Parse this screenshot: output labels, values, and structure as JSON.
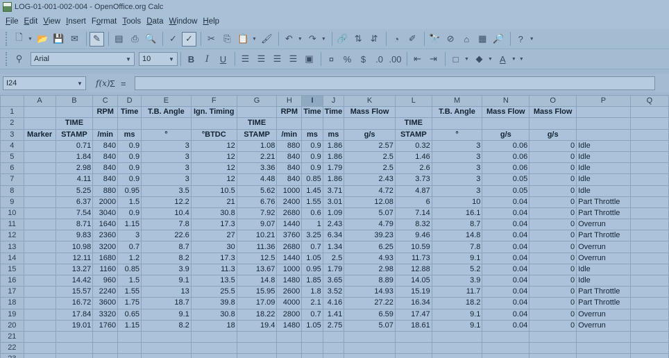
{
  "window": {
    "title": "LOG-01-001-002-004 - OpenOffice.org Calc"
  },
  "menu": [
    {
      "pre": "",
      "u": "F",
      "post": "ile"
    },
    {
      "pre": "",
      "u": "E",
      "post": "dit"
    },
    {
      "pre": "",
      "u": "V",
      "post": "iew"
    },
    {
      "pre": "",
      "u": "I",
      "post": "nsert"
    },
    {
      "pre": "F",
      "u": "o",
      "post": "rmat"
    },
    {
      "pre": "",
      "u": "T",
      "post": "ools"
    },
    {
      "pre": "",
      "u": "D",
      "post": "ata"
    },
    {
      "pre": "",
      "u": "W",
      "post": "indow"
    },
    {
      "pre": "",
      "u": "H",
      "post": "elp"
    }
  ],
  "format": {
    "font_name": "Arial",
    "font_size": "10",
    "bold": "B",
    "italic": "I",
    "underline": "U"
  },
  "formula_bar": {
    "cell_ref": "I24",
    "fx": "f(x)",
    "sigma": "Σ",
    "equals": "=",
    "content": ""
  },
  "colors": {
    "accent": "#5b7a96",
    "sheet_bg": "#aac3da",
    "header_bg": "#a7bed3"
  },
  "columns": [
    "A",
    "B",
    "C",
    "D",
    "E",
    "F",
    "G",
    "H",
    "I",
    "J",
    "K",
    "L",
    "M",
    "N",
    "O",
    "P",
    "Q"
  ],
  "selected_column": "I",
  "rows": [
    {
      "n": "1",
      "c": [
        "",
        "",
        "RPM",
        "Time",
        "T.B. Angle",
        "Ign. Timing",
        "",
        "RPM",
        "Time",
        "Time",
        "Mass Flow",
        "",
        "T.B. Angle",
        "Mass Flow",
        "Mass Flow",
        "",
        ""
      ]
    },
    {
      "n": "2",
      "c": [
        "",
        "TIME",
        "",
        "",
        "",
        "",
        "TIME",
        "",
        "",
        "",
        "",
        "TIME",
        "",
        "",
        "",
        "",
        ""
      ]
    },
    {
      "n": "3",
      "c": [
        "Marker",
        "STAMP",
        "/min",
        "ms",
        "°",
        "°BTDC",
        "STAMP",
        "/min",
        "ms",
        "ms",
        "g/s",
        "STAMP",
        "°",
        "g/s",
        "g/s",
        "",
        ""
      ]
    },
    {
      "n": "4",
      "c": [
        "",
        "0.71",
        "840",
        "0.9",
        "3",
        "12",
        "1.08",
        "880",
        "0.9",
        "1.86",
        "2.57",
        "0.32",
        "3",
        "0.06",
        "0",
        "Idle",
        ""
      ]
    },
    {
      "n": "5",
      "c": [
        "",
        "1.84",
        "840",
        "0.9",
        "3",
        "12",
        "2.21",
        "840",
        "0.9",
        "1.86",
        "2.5",
        "1.46",
        "3",
        "0.06",
        "0",
        "Idle",
        ""
      ]
    },
    {
      "n": "6",
      "c": [
        "",
        "2.98",
        "840",
        "0.9",
        "3",
        "12",
        "3.36",
        "840",
        "0.9",
        "1.79",
        "2.5",
        "2.6",
        "3",
        "0.06",
        "0",
        "Idle",
        ""
      ]
    },
    {
      "n": "7",
      "c": [
        "",
        "4.11",
        "840",
        "0.9",
        "3",
        "12",
        "4.48",
        "840",
        "0.85",
        "1.86",
        "2.43",
        "3.73",
        "3",
        "0.05",
        "0",
        "Idle",
        ""
      ]
    },
    {
      "n": "8",
      "c": [
        "",
        "5.25",
        "880",
        "0.95",
        "3.5",
        "10.5",
        "5.62",
        "1000",
        "1.45",
        "3.71",
        "4.72",
        "4.87",
        "3",
        "0.05",
        "0",
        "Idle",
        ""
      ]
    },
    {
      "n": "9",
      "c": [
        "",
        "6.37",
        "2000",
        "1.5",
        "12.2",
        "21",
        "6.76",
        "2400",
        "1.55",
        "3.01",
        "12.08",
        "6",
        "10",
        "0.04",
        "0",
        "Part Throttle",
        ""
      ]
    },
    {
      "n": "10",
      "c": [
        "",
        "7.54",
        "3040",
        "0.9",
        "10.4",
        "30.8",
        "7.92",
        "2680",
        "0.6",
        "1.09",
        "5.07",
        "7.14",
        "16.1",
        "0.04",
        "0",
        "Part Throttle",
        ""
      ]
    },
    {
      "n": "11",
      "c": [
        "",
        "8.71",
        "1640",
        "1.15",
        "7.8",
        "17.3",
        "9.07",
        "1440",
        "1",
        "2.43",
        "4.79",
        "8.32",
        "8.7",
        "0.04",
        "0",
        "Overrun",
        ""
      ]
    },
    {
      "n": "12",
      "c": [
        "",
        "9.83",
        "2360",
        "3",
        "22.6",
        "27",
        "10.21",
        "3760",
        "3.25",
        "6.34",
        "39.23",
        "9.46",
        "14.8",
        "0.04",
        "0",
        "Part Throttle",
        ""
      ]
    },
    {
      "n": "13",
      "c": [
        "",
        "10.98",
        "3200",
        "0.7",
        "8.7",
        "30",
        "11.36",
        "2680",
        "0.7",
        "1.34",
        "6.25",
        "10.59",
        "7.8",
        "0.04",
        "0",
        "Overrun",
        ""
      ]
    },
    {
      "n": "14",
      "c": [
        "",
        "12.11",
        "1680",
        "1.2",
        "8.2",
        "17.3",
        "12.5",
        "1440",
        "1.05",
        "2.5",
        "4.93",
        "11.73",
        "9.1",
        "0.04",
        "0",
        "Overrun",
        ""
      ]
    },
    {
      "n": "15",
      "c": [
        "",
        "13.27",
        "1160",
        "0.85",
        "3.9",
        "11.3",
        "13.67",
        "1000",
        "0.95",
        "1.79",
        "2.98",
        "12.88",
        "5.2",
        "0.04",
        "0",
        "Idle",
        ""
      ]
    },
    {
      "n": "16",
      "c": [
        "",
        "14.42",
        "960",
        "1.5",
        "9.1",
        "13.5",
        "14.8",
        "1480",
        "1.85",
        "3.65",
        "8.89",
        "14.05",
        "3.9",
        "0.04",
        "0",
        "Idle",
        ""
      ]
    },
    {
      "n": "17",
      "c": [
        "",
        "15.57",
        "2240",
        "1.55",
        "13",
        "25.5",
        "15.95",
        "2600",
        "1.8",
        "3.52",
        "14.93",
        "15.19",
        "11.7",
        "0.04",
        "0",
        "Part Throttle",
        ""
      ]
    },
    {
      "n": "18",
      "c": [
        "",
        "16.72",
        "3600",
        "1.75",
        "18.7",
        "39.8",
        "17.09",
        "4000",
        "2.1",
        "4.16",
        "27.22",
        "16.34",
        "18.2",
        "0.04",
        "0",
        "Part Throttle",
        ""
      ]
    },
    {
      "n": "19",
      "c": [
        "",
        "17.84",
        "3320",
        "0.65",
        "9.1",
        "30.8",
        "18.22",
        "2800",
        "0.7",
        "1.41",
        "6.59",
        "17.47",
        "9.1",
        "0.04",
        "0",
        "Overrun",
        ""
      ]
    },
    {
      "n": "20",
      "c": [
        "",
        "19.01",
        "1760",
        "1.15",
        "8.2",
        "18",
        "19.4",
        "1480",
        "1.05",
        "2.75",
        "5.07",
        "18.61",
        "9.1",
        "0.04",
        "0",
        "Overrun",
        ""
      ]
    },
    {
      "n": "21",
      "c": [
        "",
        "",
        "",
        "",
        "",
        "",
        "",
        "",
        "",
        "",
        "",
        "",
        "",
        "",
        "",
        "",
        ""
      ]
    },
    {
      "n": "22",
      "c": [
        "",
        "",
        "",
        "",
        "",
        "",
        "",
        "",
        "",
        "",
        "",
        "",
        "",
        "",
        "",
        "",
        ""
      ]
    },
    {
      "n": "23",
      "c": [
        "",
        "",
        "",
        "",
        "",
        "",
        "",
        "",
        "",
        "",
        "",
        "",
        "",
        "",
        "",
        "",
        ""
      ]
    }
  ]
}
